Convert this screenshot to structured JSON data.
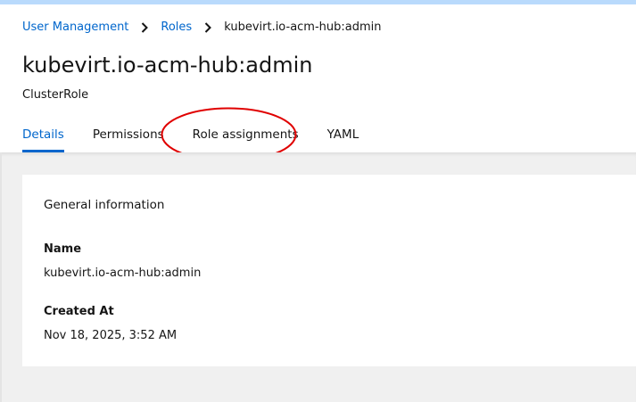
{
  "breadcrumb": {
    "items": [
      "User Management",
      "Roles"
    ],
    "current": "kubevirt.io-acm-hub:admin"
  },
  "page": {
    "title": "kubevirt.io-acm-hub:admin",
    "subtitle": "ClusterRole"
  },
  "tabs": [
    {
      "label": "Details",
      "active": true
    },
    {
      "label": "Permissions",
      "active": false
    },
    {
      "label": "Role assignments",
      "active": false
    },
    {
      "label": "YAML",
      "active": false
    }
  ],
  "general_info": {
    "title": "General information",
    "name_label": "Name",
    "name_value": "kubevirt.io-acm-hub:admin",
    "created_label": "Created At",
    "created_value": "Nov 18, 2025, 3:52 AM"
  },
  "colors": {
    "link": "#0066cc",
    "annotation": "#e00000",
    "top_strip": "#b9dafc",
    "content_background": "#f0f0f0"
  },
  "icons": {
    "breadcrumb_separator": "chevron-right-icon"
  }
}
